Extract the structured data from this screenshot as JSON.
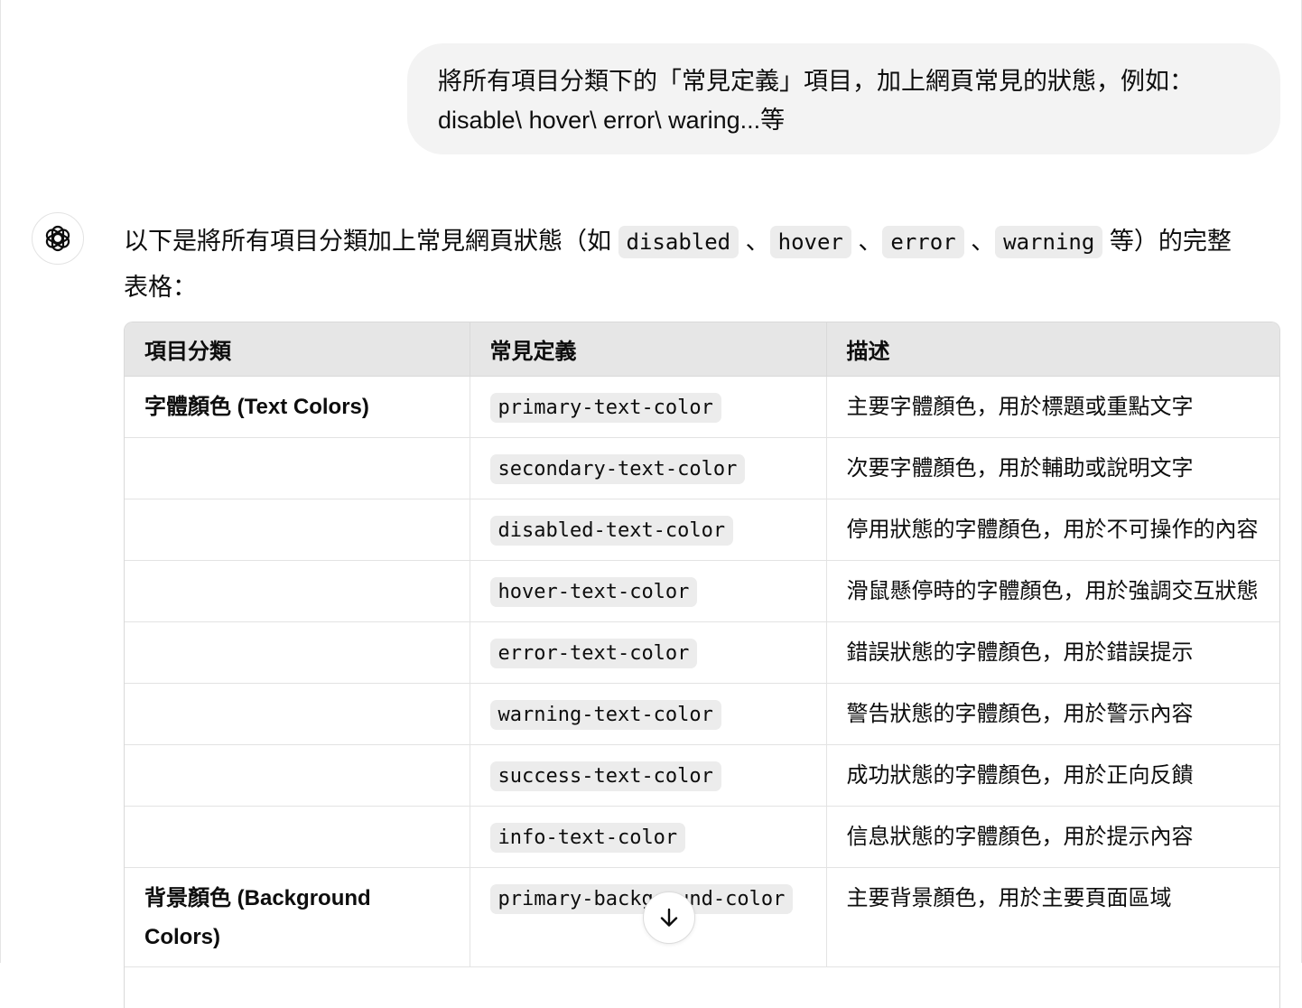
{
  "user_message": {
    "line1": "將所有項目分類下的「常見定義」項目，加上網頁常見的狀態，例如：",
    "line2": "disable\\ hover\\ error\\ waring...等"
  },
  "assistant": {
    "avatar_icon": "openai-logo-icon",
    "intro": {
      "text1": "以下是將所有項目分類加上常見網頁狀態（如 ",
      "code1": "disabled",
      "sep1": " 、",
      "code2": "hover",
      "sep2": " 、",
      "code3": "error",
      "sep3": " 、",
      "code4": "warning",
      "text2": " 等）的完整",
      "line2": "表格："
    },
    "table": {
      "headers": [
        "項目分類",
        "常見定義",
        "描述"
      ],
      "rows": [
        {
          "category": "字體顏色 (Text Colors)",
          "definition": "primary-text-color",
          "description": "主要字體顏色，用於標題或重點文字"
        },
        {
          "category": "",
          "definition": "secondary-text-color",
          "description": "次要字體顏色，用於輔助或說明文字"
        },
        {
          "category": "",
          "definition": "disabled-text-color",
          "description": "停用狀態的字體顏色，用於不可操作的內容"
        },
        {
          "category": "",
          "definition": "hover-text-color",
          "description": "滑鼠懸停時的字體顏色，用於強調交互狀態"
        },
        {
          "category": "",
          "definition": "error-text-color",
          "description": "錯誤狀態的字體顏色，用於錯誤提示"
        },
        {
          "category": "",
          "definition": "warning-text-color",
          "description": "警告狀態的字體顏色，用於警示內容"
        },
        {
          "category": "",
          "definition": "success-text-color",
          "description": "成功狀態的字體顏色，用於正向反饋"
        },
        {
          "category": "",
          "definition": "info-text-color",
          "description": "信息狀態的字體顏色，用於提示內容"
        },
        {
          "category": "背景顏色 (Background Colors)",
          "definition": "primary-background-color",
          "description": "主要背景顏色，用於主要頁面區域"
        }
      ]
    }
  },
  "scroll_button": {
    "icon": "arrow-down-icon"
  }
}
